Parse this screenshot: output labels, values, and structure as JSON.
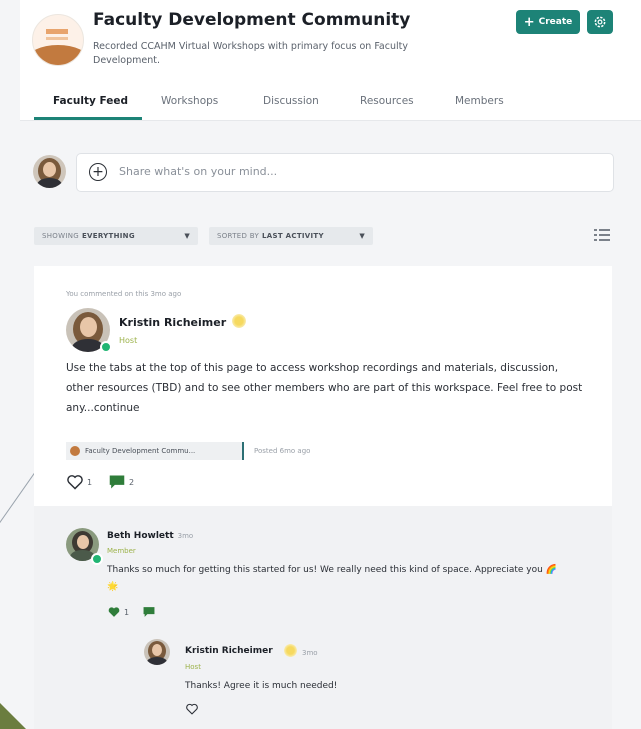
{
  "community": {
    "title": "Faculty Development Community",
    "description": "Recorded CCAHM Virtual Workshops with primary focus on Faculty Development."
  },
  "header": {
    "create_label": "Create"
  },
  "tabs": [
    {
      "label": "Faculty Feed",
      "active": true
    },
    {
      "label": "Workshops"
    },
    {
      "label": "Discussion"
    },
    {
      "label": "Resources"
    },
    {
      "label": "Members"
    }
  ],
  "composer": {
    "placeholder": "Share what's on your mind..."
  },
  "filters": {
    "show_prefix": "SHOWING",
    "show_value": "EVERYTHING",
    "sort_prefix": "SORTED BY",
    "sort_value": "LAST ACTIVITY"
  },
  "post": {
    "activity": "You commented on this 3mo ago",
    "author": "Kristin Richeimer",
    "role": "Host",
    "body": "Use the tabs at the top of this page to access workshop recordings and materials, discussion, other resources (TBD) and to see other members who are part of this workspace.  Feel free to post any...continue",
    "space_tag": "Faculty Development Commu...",
    "posted": "Posted 6mo ago",
    "likes": "1",
    "comments": "2"
  },
  "comments": [
    {
      "author": "Beth Howlett",
      "time": "3mo",
      "role": "Member",
      "text": "Thanks so much for getting this started for us! We really need this kind of space. Appreciate you 🌈🌟",
      "likes": "1"
    },
    {
      "author": "Kristin Richeimer",
      "time": "3mo",
      "role": "Host",
      "text": "Thanks! Agree it is much needed!"
    }
  ],
  "colors": {
    "accent": "#1d8377",
    "online": "#21b573",
    "role": "#9cb24a"
  },
  "icons": [
    "plus-icon",
    "gear-icon",
    "add-circle-icon",
    "caret-down-icon",
    "list-view-icon",
    "star-badge-icon",
    "heart-icon",
    "comment-icon"
  ]
}
